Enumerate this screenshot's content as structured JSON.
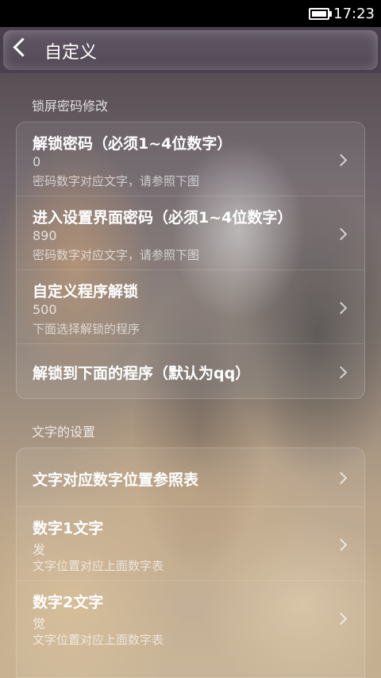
{
  "status_bar": {
    "time": "17:23"
  },
  "app_bar": {
    "title": "自定义"
  },
  "sections": [
    {
      "label": "锁屏密码修改",
      "items": [
        {
          "title": "解锁密码（必须1~4位数字）",
          "value": "0",
          "subtitle": "密码数字对应文字，请参照下图"
        },
        {
          "title": "进入设置界面密码（必须1~4位数字）",
          "value": "890",
          "subtitle": "密码数字对应文字，请参照下图"
        },
        {
          "title": "自定义程序解锁",
          "value": "500",
          "subtitle": "下面选择解锁的程序"
        },
        {
          "title": "解锁到下面的程序（默认为qq）"
        }
      ]
    },
    {
      "label": "文字的设置",
      "items": [
        {
          "title": "文字对应数字位置参照表"
        },
        {
          "title": "数字1文字",
          "value": "发",
          "subtitle": "文字位置对应上面数字表"
        },
        {
          "title": "数字2文字",
          "value": "觉",
          "subtitle": "文字位置对应上面数字表"
        }
      ]
    }
  ]
}
